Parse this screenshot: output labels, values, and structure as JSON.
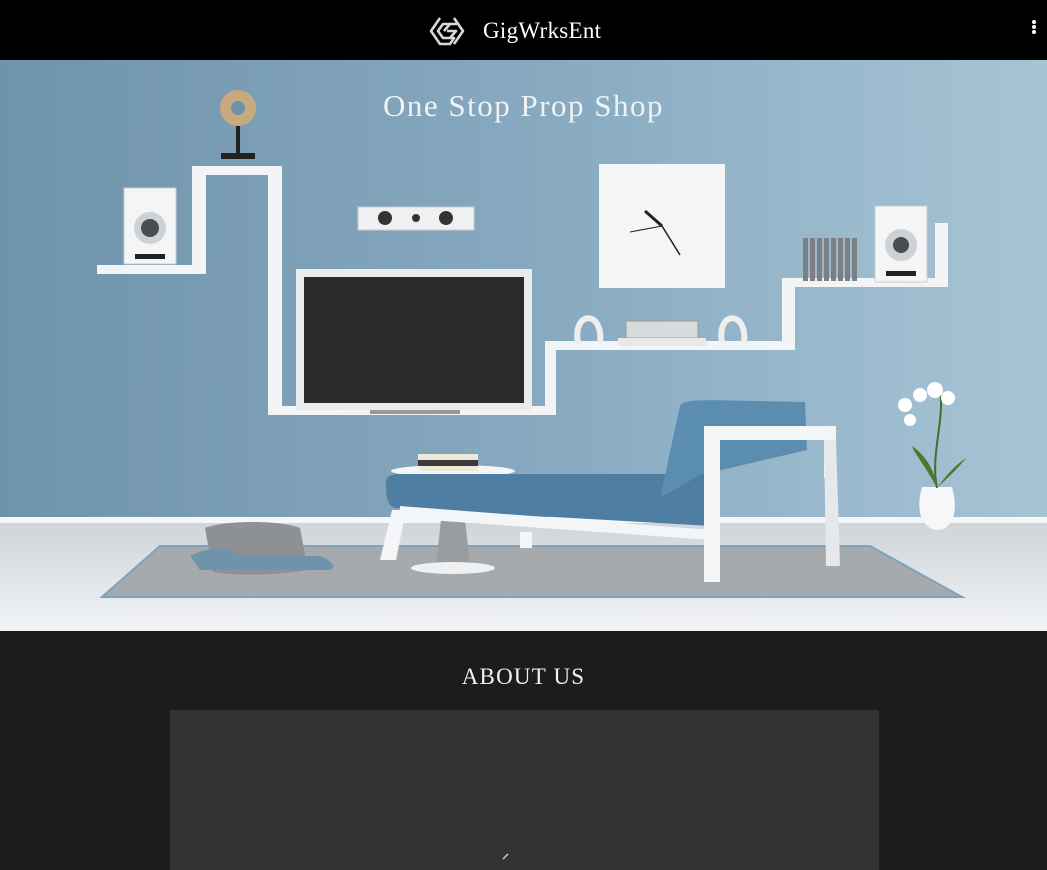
{
  "header": {
    "brand_name": "GigWrksEnt",
    "logo_icon": "diamond-logo-icon",
    "menu_icon": "more-vertical-icon"
  },
  "hero": {
    "title": "One Stop Prop Shop",
    "image": "living-room-hero-image"
  },
  "about": {
    "title": "ABOUT US"
  },
  "colors": {
    "header_bg": "#000000",
    "wall": "#7fa3bb",
    "floor": "#e8ebee",
    "section_bg": "#1b1c1e",
    "panel_bg": "#323232"
  }
}
